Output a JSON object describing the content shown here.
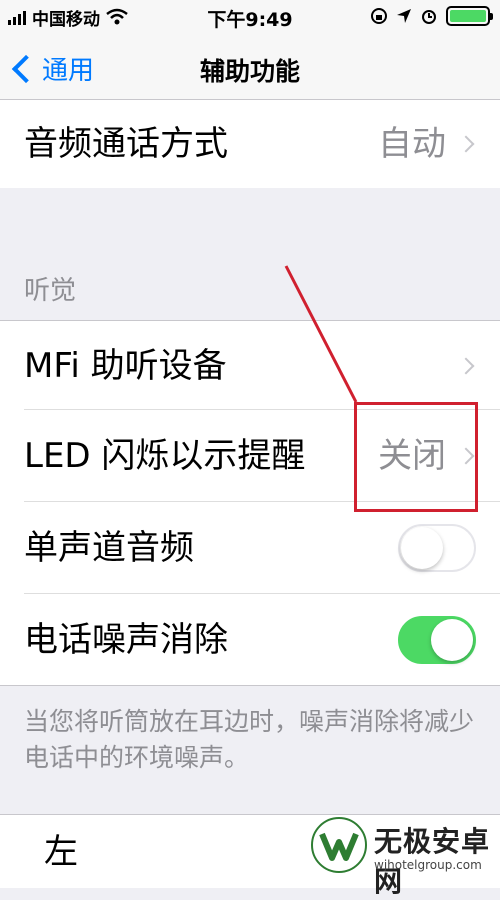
{
  "status_bar": {
    "carrier": "中国移动",
    "time": "下午9:49",
    "battery_color": "#4cd964"
  },
  "nav": {
    "back_label": "通用",
    "title": "辅助功能"
  },
  "rows": {
    "audio_call": {
      "label": "音频通话方式",
      "value": "自动"
    },
    "mfi": {
      "label": "MFi 助听设备"
    },
    "led": {
      "label": "LED 闪烁以示提醒",
      "value": "关闭"
    },
    "mono": {
      "label": "单声道音频",
      "enabled": false
    },
    "noise": {
      "label": "电话噪声消除",
      "enabled": true
    },
    "balance": {
      "label": "左"
    }
  },
  "section": {
    "hearing": "听觉"
  },
  "footer": {
    "noise_note": "当您将听筒放在耳边时，噪声消除将减少电话中的环境噪声。"
  },
  "watermark": {
    "name": "无极安卓网",
    "url": "wjhotelgroup.com"
  },
  "colors": {
    "accent": "#007aff",
    "switch_on": "#4cd964",
    "annotation": "#d0202f"
  },
  "icons": [
    "chevron-left-icon",
    "wifi-icon",
    "lock-rotation-icon",
    "location-icon",
    "alarm-icon",
    "battery-icon",
    "chevron-right-icon"
  ]
}
